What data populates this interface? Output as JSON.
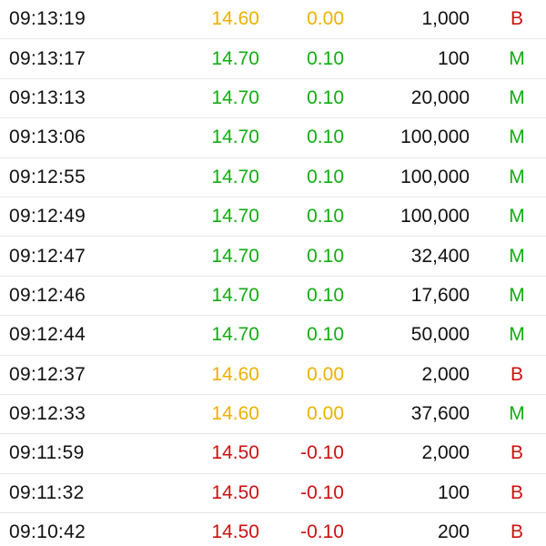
{
  "colors": {
    "up": "#12ad12",
    "flat": "#ecb100",
    "down": "#cc1111",
    "text": "#111111",
    "divider": "#e6e6e6"
  },
  "trades": [
    {
      "time": "09:13:19",
      "price": "14.60",
      "change": "0.00",
      "volume": "1,000",
      "side": "B",
      "trend": "flat"
    },
    {
      "time": "09:13:17",
      "price": "14.70",
      "change": "0.10",
      "volume": "100",
      "side": "M",
      "trend": "up"
    },
    {
      "time": "09:13:13",
      "price": "14.70",
      "change": "0.10",
      "volume": "20,000",
      "side": "M",
      "trend": "up"
    },
    {
      "time": "09:13:06",
      "price": "14.70",
      "change": "0.10",
      "volume": "100,000",
      "side": "M",
      "trend": "up"
    },
    {
      "time": "09:12:55",
      "price": "14.70",
      "change": "0.10",
      "volume": "100,000",
      "side": "M",
      "trend": "up"
    },
    {
      "time": "09:12:49",
      "price": "14.70",
      "change": "0.10",
      "volume": "100,000",
      "side": "M",
      "trend": "up"
    },
    {
      "time": "09:12:47",
      "price": "14.70",
      "change": "0.10",
      "volume": "32,400",
      "side": "M",
      "trend": "up"
    },
    {
      "time": "09:12:46",
      "price": "14.70",
      "change": "0.10",
      "volume": "17,600",
      "side": "M",
      "trend": "up"
    },
    {
      "time": "09:12:44",
      "price": "14.70",
      "change": "0.10",
      "volume": "50,000",
      "side": "M",
      "trend": "up"
    },
    {
      "time": "09:12:37",
      "price": "14.60",
      "change": "0.00",
      "volume": "2,000",
      "side": "B",
      "trend": "flat"
    },
    {
      "time": "09:12:33",
      "price": "14.60",
      "change": "0.00",
      "volume": "37,600",
      "side": "M",
      "trend": "flat"
    },
    {
      "time": "09:11:59",
      "price": "14.50",
      "change": "-0.10",
      "volume": "2,000",
      "side": "B",
      "trend": "down"
    },
    {
      "time": "09:11:32",
      "price": "14.50",
      "change": "-0.10",
      "volume": "100",
      "side": "B",
      "trend": "down"
    },
    {
      "time": "09:10:42",
      "price": "14.50",
      "change": "-0.10",
      "volume": "200",
      "side": "B",
      "trend": "down"
    }
  ]
}
